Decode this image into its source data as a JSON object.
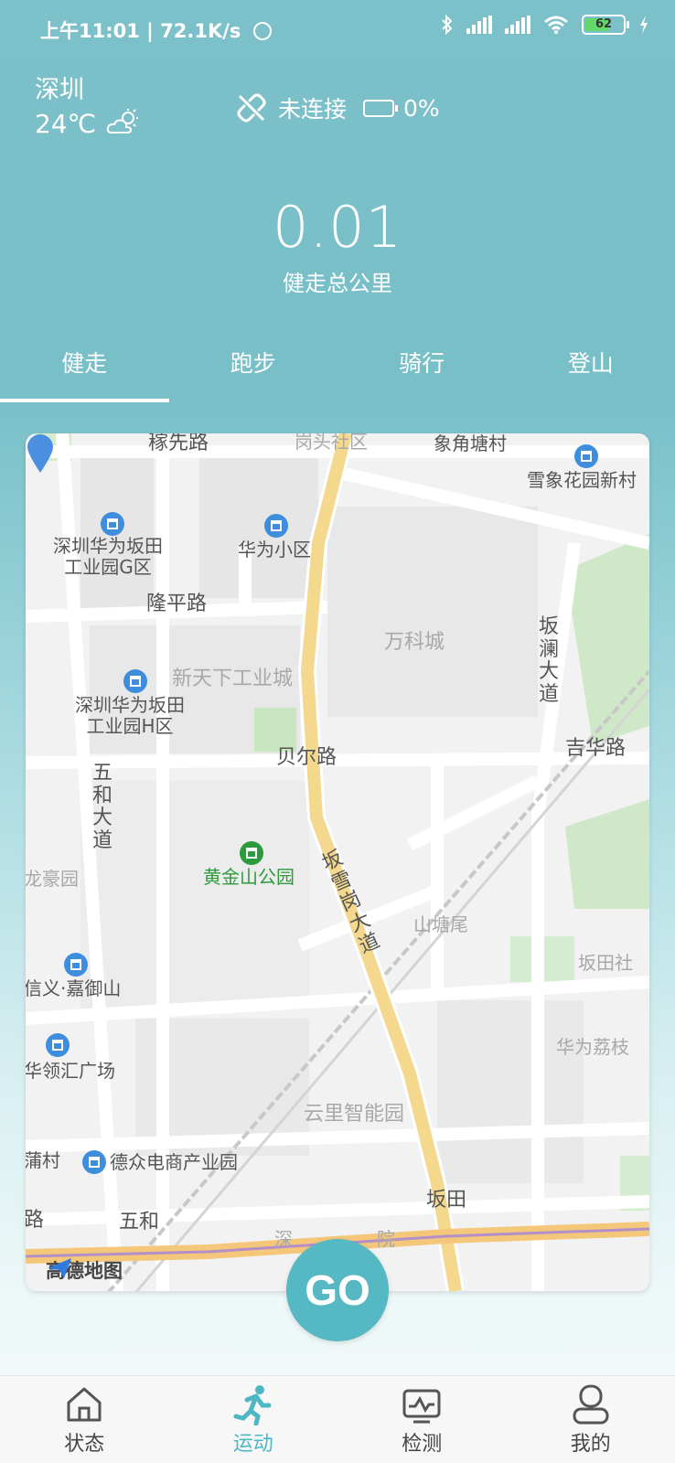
{
  "status_bar": {
    "time": "上午11:01",
    "speed": "72.1K/s",
    "battery_level": "62",
    "accent_battery_color": "#64d86b"
  },
  "header": {
    "city": "深圳",
    "temperature": "24℃",
    "weather_icon": "partly-cloudy-icon",
    "connection_status": "未连接",
    "device_battery": "0%"
  },
  "summary": {
    "total_value": "0.01",
    "total_label": "健走总公里"
  },
  "tabs": [
    {
      "label": "健走",
      "active": true
    },
    {
      "label": "跑步",
      "active": false
    },
    {
      "label": "骑行",
      "active": false
    },
    {
      "label": "登山",
      "active": false
    }
  ],
  "map": {
    "labels": {
      "jixian_road": "稼先路",
      "gangtou": "岗头社区",
      "xiangjiaotang": "象角塘村",
      "xuexiang": "雪象花园新村",
      "huawei_g": "深圳华为坂田\n工业园G区",
      "huawei_xiaoqu": "华为小区",
      "longping_road": "隆平路",
      "vanke": "万科城",
      "xintianxia": "新天下工业城",
      "huawei_h": "深圳华为坂田\n工业园H区",
      "beier_road": "贝尔路",
      "jihua_road": "吉华路",
      "wuhe_avenue": "五和大道",
      "banlan_avenue": "坂澜大道",
      "huangjinshan": "黄金山公园",
      "longhaoyuan": "龙豪园",
      "bangxuegang": "坂雪岗大道",
      "shantangwei": "山塘尾",
      "xinyi": "信义·嘉御山",
      "bantian_she": "坂田社",
      "linghui": "华领汇广场",
      "huawei_li": "华为荔枝",
      "yunli": "云里智能园",
      "puccun": "蒲村",
      "dezhong": "德众电商产业园",
      "bantian": "坂田",
      "wuhe": "五和",
      "road_left": "路",
      "shen": "深",
      "yuan": "院"
    },
    "attribution": "高德地图"
  },
  "go_button": {
    "label": "GO",
    "color": "#55b8c2"
  },
  "bottom_nav": [
    {
      "label": "状态",
      "icon": "home-icon",
      "active": false
    },
    {
      "label": "运动",
      "icon": "running-icon",
      "active": true
    },
    {
      "label": "检测",
      "icon": "monitor-icon",
      "active": false
    },
    {
      "label": "我的",
      "icon": "user-icon",
      "active": false
    }
  ],
  "colors": {
    "header_bg": "#7cc0c9",
    "active_nav": "#4db8c4",
    "map_road_main": "#f4d88e"
  }
}
